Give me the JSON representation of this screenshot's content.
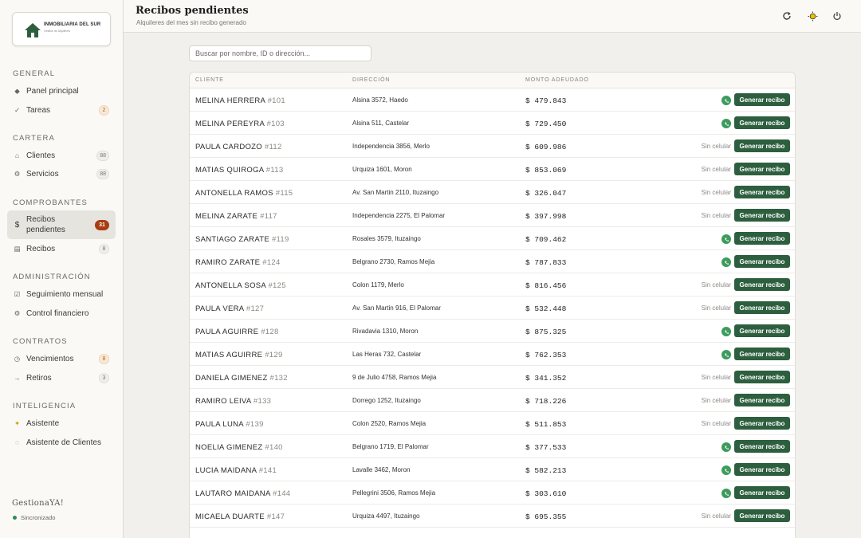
{
  "logo": {
    "title": "INMOBILIARIA DEL SUR",
    "subtitle": "Gestión de Alquileres"
  },
  "sidebar": {
    "sections": [
      {
        "title": "General",
        "items": [
          {
            "label": "Panel principal",
            "icon": "diamond-icon",
            "badge": ""
          },
          {
            "label": "Tareas",
            "icon": "check-icon",
            "badge": "2"
          }
        ]
      },
      {
        "title": "Cartera",
        "items": [
          {
            "label": "Clientes",
            "icon": "home-icon",
            "badge": "88"
          },
          {
            "label": "Servicios",
            "icon": "gear-icon",
            "badge": "88"
          }
        ]
      },
      {
        "title": "Comprobantes",
        "items": [
          {
            "label": "Recibos pendientes",
            "icon": "dollar-icon",
            "badge": "31",
            "active": true
          },
          {
            "label": "Recibos",
            "icon": "receipt-icon",
            "badge": "8"
          }
        ]
      },
      {
        "title": "Administración",
        "items": [
          {
            "label": "Seguimiento mensual",
            "icon": "checkbox-icon",
            "badge": ""
          },
          {
            "label": "Control financiero",
            "icon": "gear-icon",
            "badge": ""
          }
        ]
      },
      {
        "title": "Contratos",
        "items": [
          {
            "label": "Vencimientos",
            "icon": "clock-icon",
            "badge": "8"
          },
          {
            "label": "Retiros",
            "icon": "exit-icon",
            "badge": "3"
          }
        ]
      },
      {
        "title": "Inteligencia",
        "items": [
          {
            "label": "Asistente",
            "icon": "sparkle-icon",
            "badge": ""
          },
          {
            "label": "Asistente de Clientes",
            "icon": "chat-icon",
            "badge": ""
          }
        ]
      }
    ],
    "brand": "GestionaYA!",
    "status": "Sincronizado"
  },
  "header": {
    "title": "Recibos pendientes",
    "subtitle": "Alquileres del mes sin recibo generado"
  },
  "search": {
    "placeholder": "Buscar por nombre, ID o dirección..."
  },
  "table": {
    "columns": {
      "client": "Cliente",
      "address": "Dirección",
      "amount": "Monto adeudado"
    },
    "button_label": "Generar recibo",
    "no_phone_label": "Sin celular",
    "rows": [
      {
        "name": "MELINA HERRERA",
        "id": "#101",
        "address": "Alsina 3572, Haedo",
        "amount": "$ 479.843",
        "whatsapp": true
      },
      {
        "name": "MELINA PEREYRA",
        "id": "#103",
        "address": "Alsina 511, Castelar",
        "amount": "$ 729.450",
        "whatsapp": true
      },
      {
        "name": "PAULA CARDOZO",
        "id": "#112",
        "address": "Independencia 3856, Merlo",
        "amount": "$ 609.986",
        "whatsapp": false
      },
      {
        "name": "MATIAS QUIROGA",
        "id": "#113",
        "address": "Urquiza 1601, Moron",
        "amount": "$ 853.069",
        "whatsapp": false
      },
      {
        "name": "ANTONELLA RAMOS",
        "id": "#115",
        "address": "Av. San Martin 2110, Ituzaingo",
        "amount": "$ 326.047",
        "whatsapp": false
      },
      {
        "name": "MELINA ZARATE",
        "id": "#117",
        "address": "Independencia 2275, El Palomar",
        "amount": "$ 397.998",
        "whatsapp": false
      },
      {
        "name": "SANTIAGO ZARATE",
        "id": "#119",
        "address": "Rosales 3579, Ituzaingo",
        "amount": "$ 709.462",
        "whatsapp": true
      },
      {
        "name": "RAMIRO ZARATE",
        "id": "#124",
        "address": "Belgrano 2730, Ramos Mejia",
        "amount": "$ 787.833",
        "whatsapp": true
      },
      {
        "name": "ANTONELLA SOSA",
        "id": "#125",
        "address": "Colon 1179, Merlo",
        "amount": "$ 816.456",
        "whatsapp": false
      },
      {
        "name": "PAULA VERA",
        "id": "#127",
        "address": "Av. San Martin 916, El Palomar",
        "amount": "$ 532.448",
        "whatsapp": false
      },
      {
        "name": "PAULA AGUIRRE",
        "id": "#128",
        "address": "Rivadavia 1310, Moron",
        "amount": "$ 875.325",
        "whatsapp": true
      },
      {
        "name": "MATIAS AGUIRRE",
        "id": "#129",
        "address": "Las Heras 732, Castelar",
        "amount": "$ 762.353",
        "whatsapp": true
      },
      {
        "name": "DANIELA GIMENEZ",
        "id": "#132",
        "address": "9 de Julio 4758, Ramos Mejia",
        "amount": "$ 341.352",
        "whatsapp": false
      },
      {
        "name": "RAMIRO LEIVA",
        "id": "#133",
        "address": "Dorrego 1252, Ituzaingo",
        "amount": "$ 718.226",
        "whatsapp": false
      },
      {
        "name": "PAULA LUNA",
        "id": "#139",
        "address": "Colon 2520, Ramos Mejia",
        "amount": "$ 511.853",
        "whatsapp": false
      },
      {
        "name": "NOELIA GIMENEZ",
        "id": "#140",
        "address": "Belgrano 1719, El Palomar",
        "amount": "$ 377.533",
        "whatsapp": true
      },
      {
        "name": "LUCIA MAIDANA",
        "id": "#141",
        "address": "Lavalle 3462, Moron",
        "amount": "$ 582.213",
        "whatsapp": true
      },
      {
        "name": "LAUTARO MAIDANA",
        "id": "#144",
        "address": "Pellegrini 3506, Ramos Mejia",
        "amount": "$ 303.610",
        "whatsapp": true
      },
      {
        "name": "MICAELA DUARTE",
        "id": "#147",
        "address": "Urquiza 4497, Ituzaingo",
        "amount": "$ 695.355",
        "whatsapp": false
      }
    ]
  },
  "colors": {
    "accent": "#2d5f3f",
    "whatsapp": "#3e9b5e",
    "badge_active": "#a83d12"
  }
}
